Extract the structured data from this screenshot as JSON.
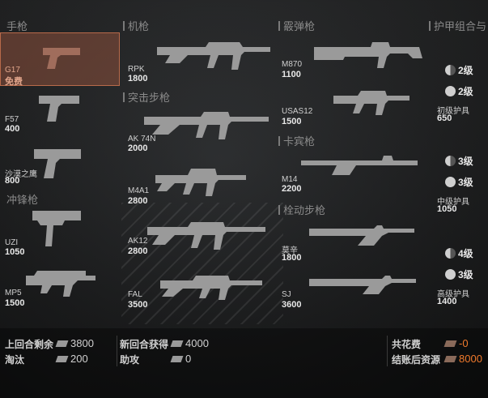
{
  "categories": {
    "pistol": "手枪",
    "mg": "机枪",
    "shotgun": "霰弹枪",
    "armor": "护甲组合与",
    "assault": "突击步枪",
    "smg": "冲锋枪",
    "carbine": "卡宾枪",
    "bolt": "栓动步枪"
  },
  "weapons": {
    "g17": {
      "name": "G17",
      "price": "免费"
    },
    "f57": {
      "name": "F57",
      "price": "400"
    },
    "deagle": {
      "name": "沙漠之鹰",
      "price": "800"
    },
    "uzi": {
      "name": "UZI",
      "price": "1050"
    },
    "mp5": {
      "name": "MP5",
      "price": "1500"
    },
    "rpk": {
      "name": "RPK",
      "price": "1800"
    },
    "ak74n": {
      "name": "AK 74N",
      "price": "2000"
    },
    "m4a1": {
      "name": "M4A1",
      "price": "2800"
    },
    "ak12": {
      "name": "AK12",
      "price": "2800"
    },
    "fal": {
      "name": "FAL",
      "price": "3500"
    },
    "m870": {
      "name": "M870",
      "price": "1100"
    },
    "usas12": {
      "name": "USAS12",
      "price": "1500"
    },
    "m14": {
      "name": "M14",
      "price": "2200"
    },
    "mosin": {
      "name": "莫辛",
      "price": "1800"
    },
    "sj": {
      "name": "SJ",
      "price": "3600"
    }
  },
  "armor": {
    "basic": {
      "name": "初级护具",
      "price": "650",
      "head": "2级",
      "body": "2级"
    },
    "mid": {
      "name": "中级护具",
      "price": "1050",
      "head": "3级",
      "body": "3级"
    },
    "high": {
      "name": "高级护具",
      "price": "1400",
      "head": "4级",
      "body": "3级"
    }
  },
  "footer": {
    "last_round_label": "上回合剩余",
    "last_round_value": "3800",
    "elim_label": "淘汰",
    "elim_value": "200",
    "new_round_label": "新回合获得",
    "new_round_value": "4000",
    "assist_label": "助攻",
    "assist_value": "0",
    "spent_label": "共花费",
    "spent_value": "-0",
    "after_label": "结账后资源",
    "after_value": "8000"
  },
  "colors": {
    "selected": "#8c503c",
    "accent": "#f07a2c"
  }
}
